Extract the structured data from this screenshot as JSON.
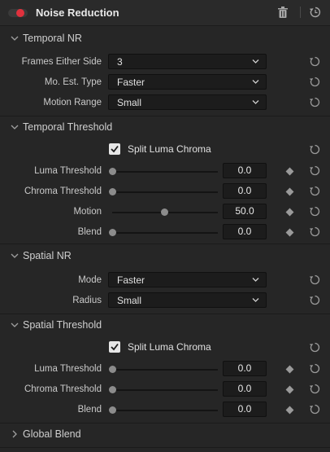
{
  "header": {
    "title": "Noise Reduction",
    "enabled": true,
    "accent": "#e0313d"
  },
  "temporal_nr": {
    "title": "Temporal NR",
    "frames_label": "Frames Either Side",
    "frames_value": "3",
    "moest_label": "Mo. Est. Type",
    "moest_value": "Faster",
    "motion_range_label": "Motion Range",
    "motion_range_value": "Small"
  },
  "temporal_threshold": {
    "title": "Temporal Threshold",
    "split_label": "Split Luma Chroma",
    "split_checked": true,
    "luma_label": "Luma Threshold",
    "luma_value": "0.0",
    "luma_level": 0,
    "chroma_label": "Chroma Threshold",
    "chroma_value": "0.0",
    "chroma_level": 0,
    "motion_label": "Motion",
    "motion_value": "50.0",
    "motion_level": 0.5,
    "blend_label": "Blend",
    "blend_value": "0.0",
    "blend_level": 0
  },
  "spatial_nr": {
    "title": "Spatial NR",
    "mode_label": "Mode",
    "mode_value": "Faster",
    "radius_label": "Radius",
    "radius_value": "Small"
  },
  "spatial_threshold": {
    "title": "Spatial Threshold",
    "split_label": "Split Luma Chroma",
    "split_checked": true,
    "luma_label": "Luma Threshold",
    "luma_value": "0.0",
    "luma_level": 0,
    "chroma_label": "Chroma Threshold",
    "chroma_value": "0.0",
    "chroma_level": 0,
    "blend_label": "Blend",
    "blend_value": "0.0",
    "blend_level": 0
  },
  "global_blend": {
    "title": "Global Blend",
    "expanded": false
  },
  "icons": {
    "header_toggle": "toggle-switch-icon",
    "trash": "trash-icon",
    "header_reset": "reset-all-icon",
    "reset": "reset-icon",
    "keyframe": "keyframe-diamond-icon",
    "dropdown": "chevron-down-icon",
    "section_open": "chevron-down-icon",
    "section_closed": "chevron-right-icon"
  }
}
